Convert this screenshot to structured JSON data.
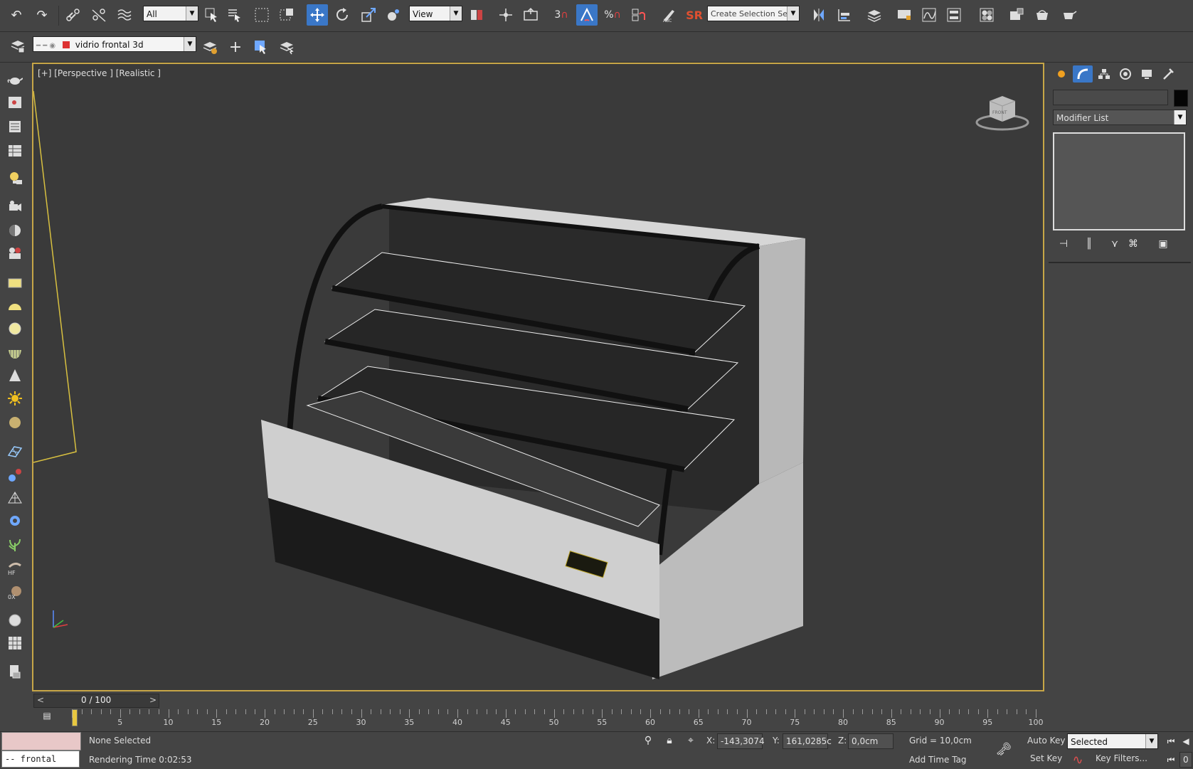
{
  "toolbar": {
    "selection_filter": "All",
    "ref_coord": "View",
    "snap_angle_label": "3",
    "snap_percent": "%",
    "srcolor": "SR",
    "named_selection": "Create Selection Se"
  },
  "layer_bar": {
    "current_layer": "vidrio frontal 3d"
  },
  "viewport": {
    "label": "[+] [Perspective ] [Realistic ]",
    "viewcube_text": "FRONT"
  },
  "command_panel": {
    "modifier_list": "Modifier List"
  },
  "timeline": {
    "frame_counter": "0 / 100",
    "prev": "<",
    "next": ">",
    "ticks": [
      "5",
      "10",
      "15",
      "20",
      "25",
      "30",
      "35",
      "40",
      "45",
      "50",
      "55",
      "60",
      "65",
      "70",
      "75",
      "80",
      "85",
      "90",
      "95",
      "100"
    ]
  },
  "status": {
    "script_line": "--  frontal",
    "selection": "None Selected",
    "render_time": "Rendering Time  0:02:53",
    "x_label": "X:",
    "x_value": "-143,3074",
    "y_label": "Y:",
    "y_value": "161,0285c",
    "z_label": "Z:",
    "z_value": "0,0cm",
    "grid": "Grid = 10,0cm",
    "add_time_tag": "Add Time Tag",
    "auto_key": "Auto Key",
    "set_key": "Set Key",
    "key_mode": "Selected",
    "key_filters": "Key Filters...",
    "frame_field": "0"
  },
  "colors": {
    "accent": "#3a77c7",
    "viewport_border": "#c7a647",
    "viewport_bg": "#3a3a3a",
    "ui_bg": "#444444"
  }
}
